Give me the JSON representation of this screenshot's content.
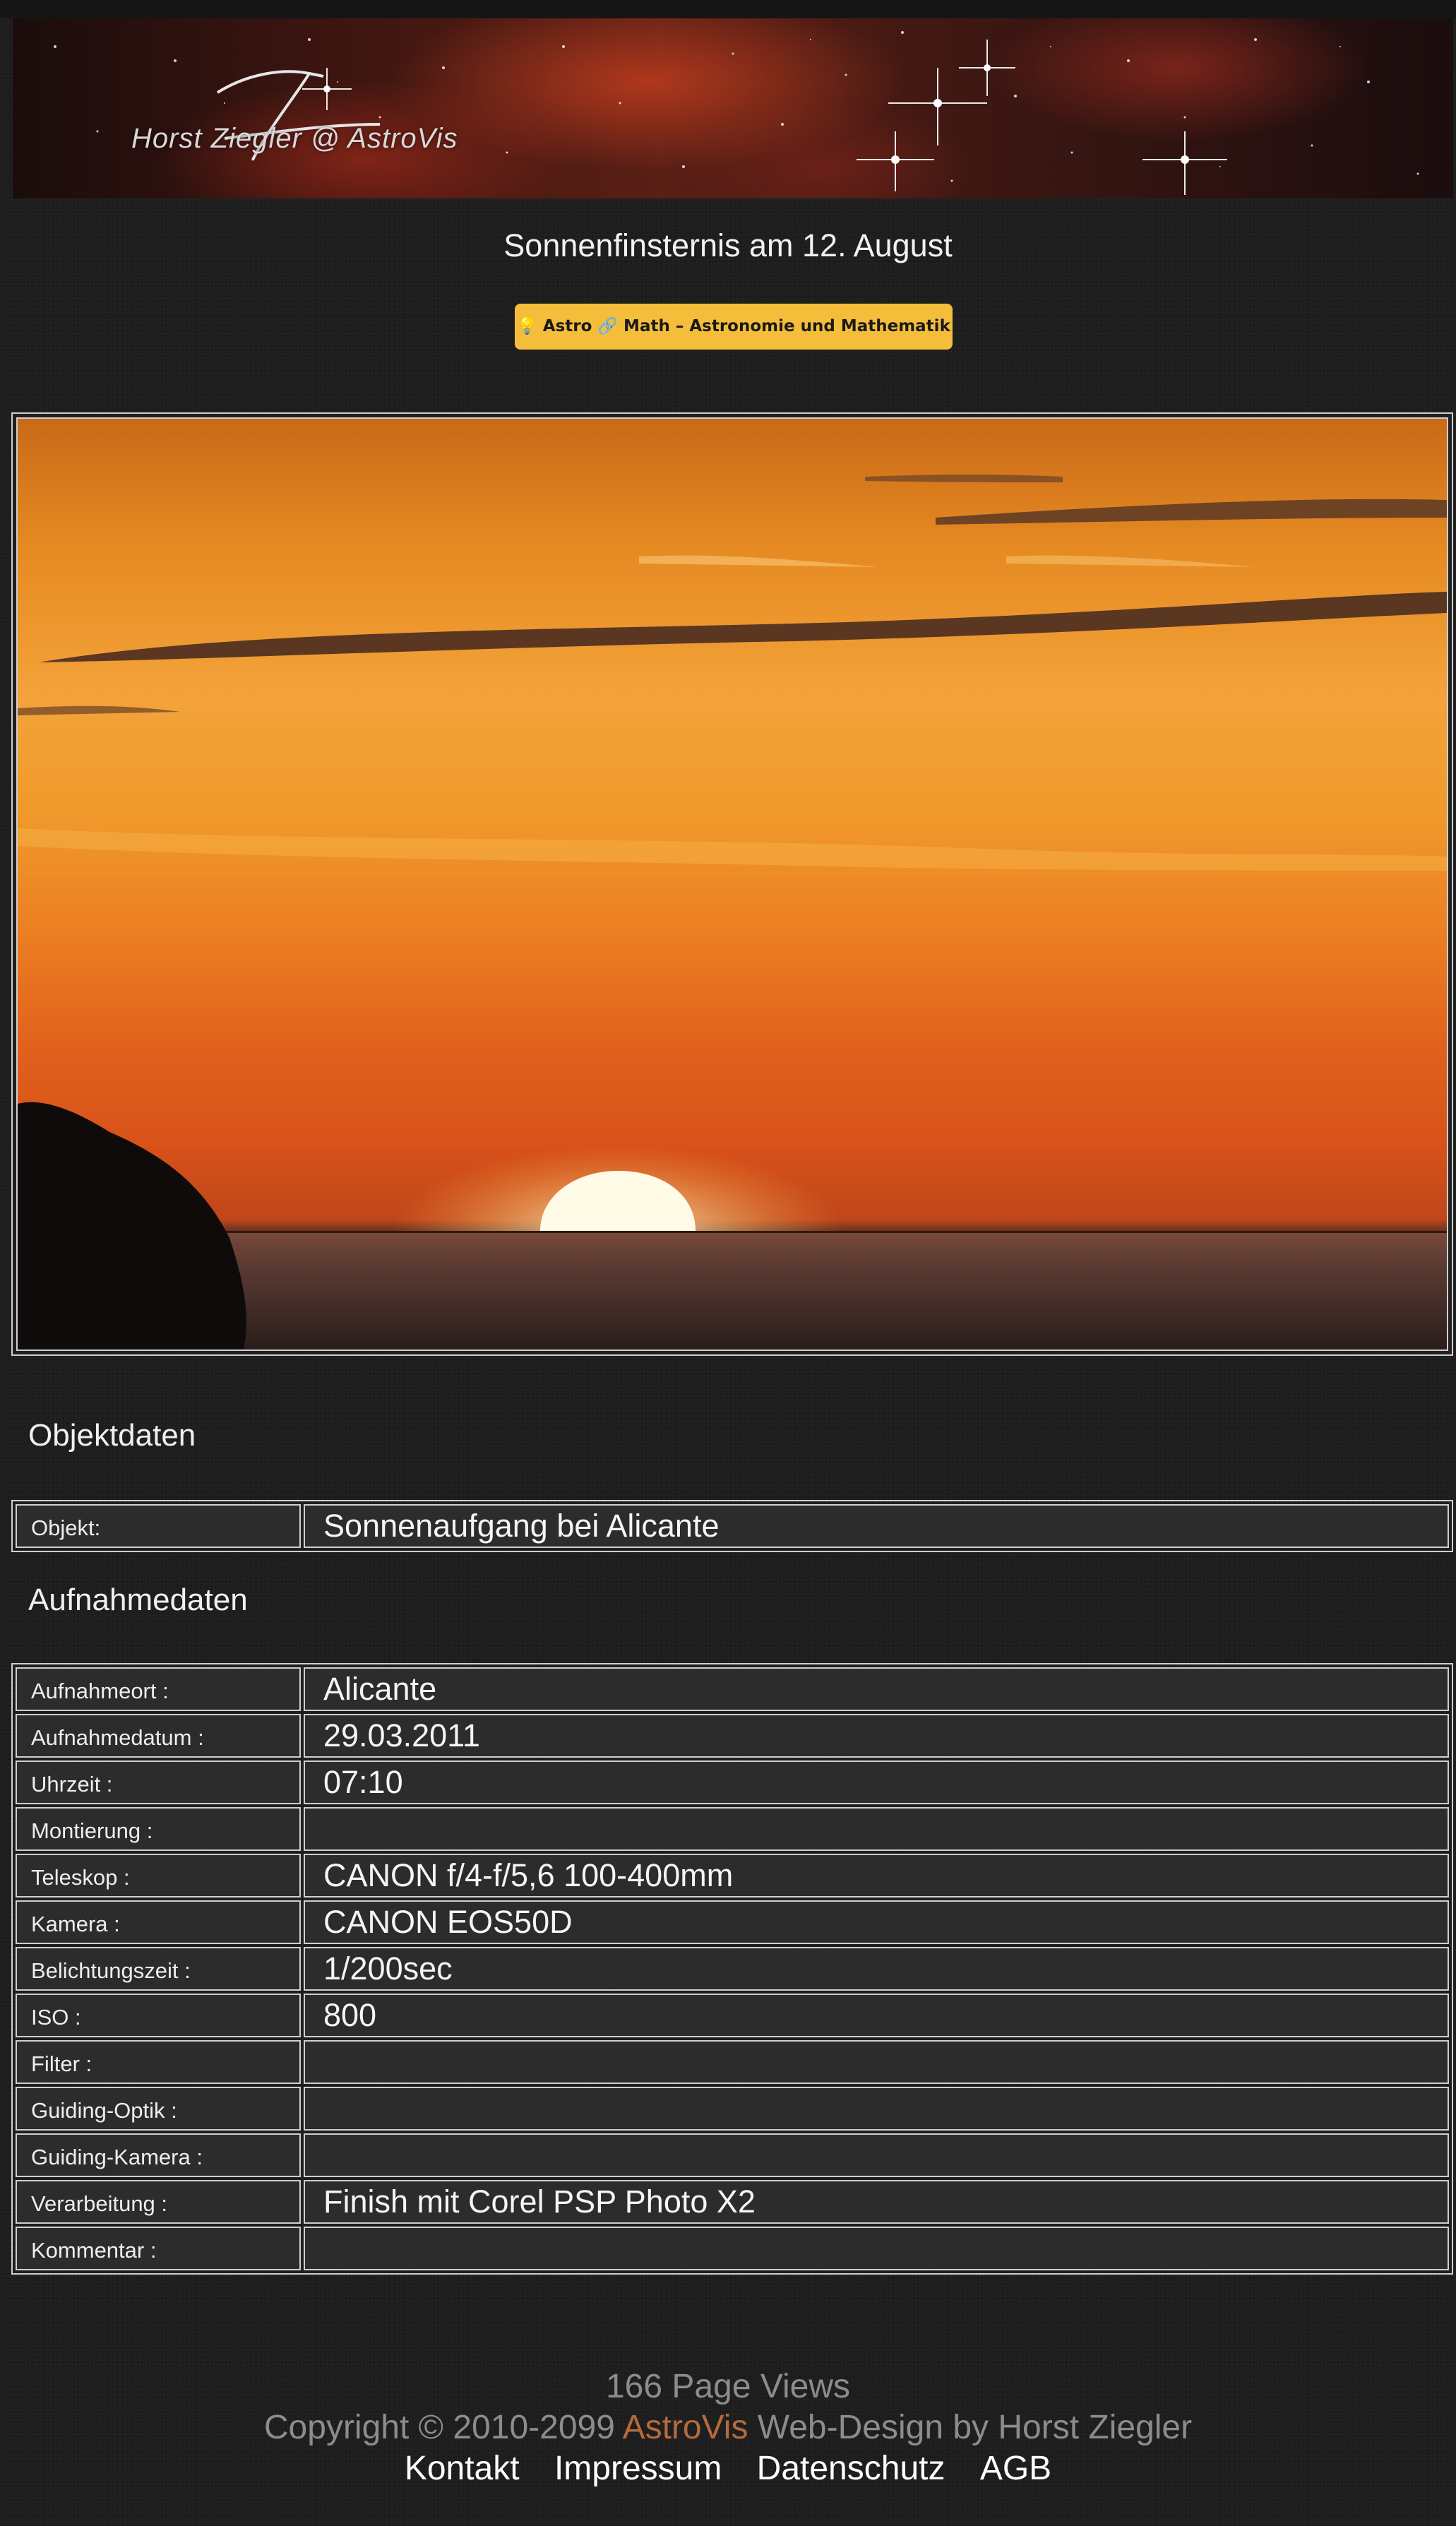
{
  "header": {
    "banner_text": "Horst Ziegler @ AstroVis"
  },
  "page_title": "Sonnenfinsternis am 12. August",
  "nav_button": {
    "label": "💡 Astro 🔗 Math – Astronomie und Mathematik"
  },
  "sections": {
    "object_heading": "Objektdaten",
    "capture_heading": "Aufnahmedaten"
  },
  "object_rows": [
    {
      "label": "Objekt:",
      "value": "Sonnenaufgang bei Alicante"
    }
  ],
  "capture_rows": [
    {
      "label": "Aufnahmeort :",
      "value": "Alicante"
    },
    {
      "label": "Aufnahmedatum :",
      "value": "29.03.2011"
    },
    {
      "label": "Uhrzeit :",
      "value": "07:10"
    },
    {
      "label": "Montierung :",
      "value": ""
    },
    {
      "label": "Teleskop :",
      "value": "CANON f/4-f/5,6 100-400mm"
    },
    {
      "label": "Kamera :",
      "value": "CANON EOS50D"
    },
    {
      "label": "Belichtungszeit :",
      "value": "1/200sec"
    },
    {
      "label": "ISO :",
      "value": "800"
    },
    {
      "label": "Filter :",
      "value": ""
    },
    {
      "label": "Guiding-Optik :",
      "value": ""
    },
    {
      "label": "Guiding-Kamera :",
      "value": ""
    },
    {
      "label": "Verarbeitung :",
      "value": "Finish mit Corel PSP Photo X2"
    },
    {
      "label": "Kommentar :",
      "value": ""
    }
  ],
  "footer": {
    "views": "166 Page Views",
    "copyright_prefix": "Copyright © 2010-2099",
    "brand": "AstroVis",
    "copyright_suffix": "Web-Design by Horst Ziegler",
    "links": [
      "Kontakt",
      "Impressum",
      "Datenschutz",
      "AGB"
    ]
  },
  "colors": {
    "accent_button": "#f4be3b",
    "brand": "#b36b3d",
    "footer_text": "#8c8c8c"
  }
}
